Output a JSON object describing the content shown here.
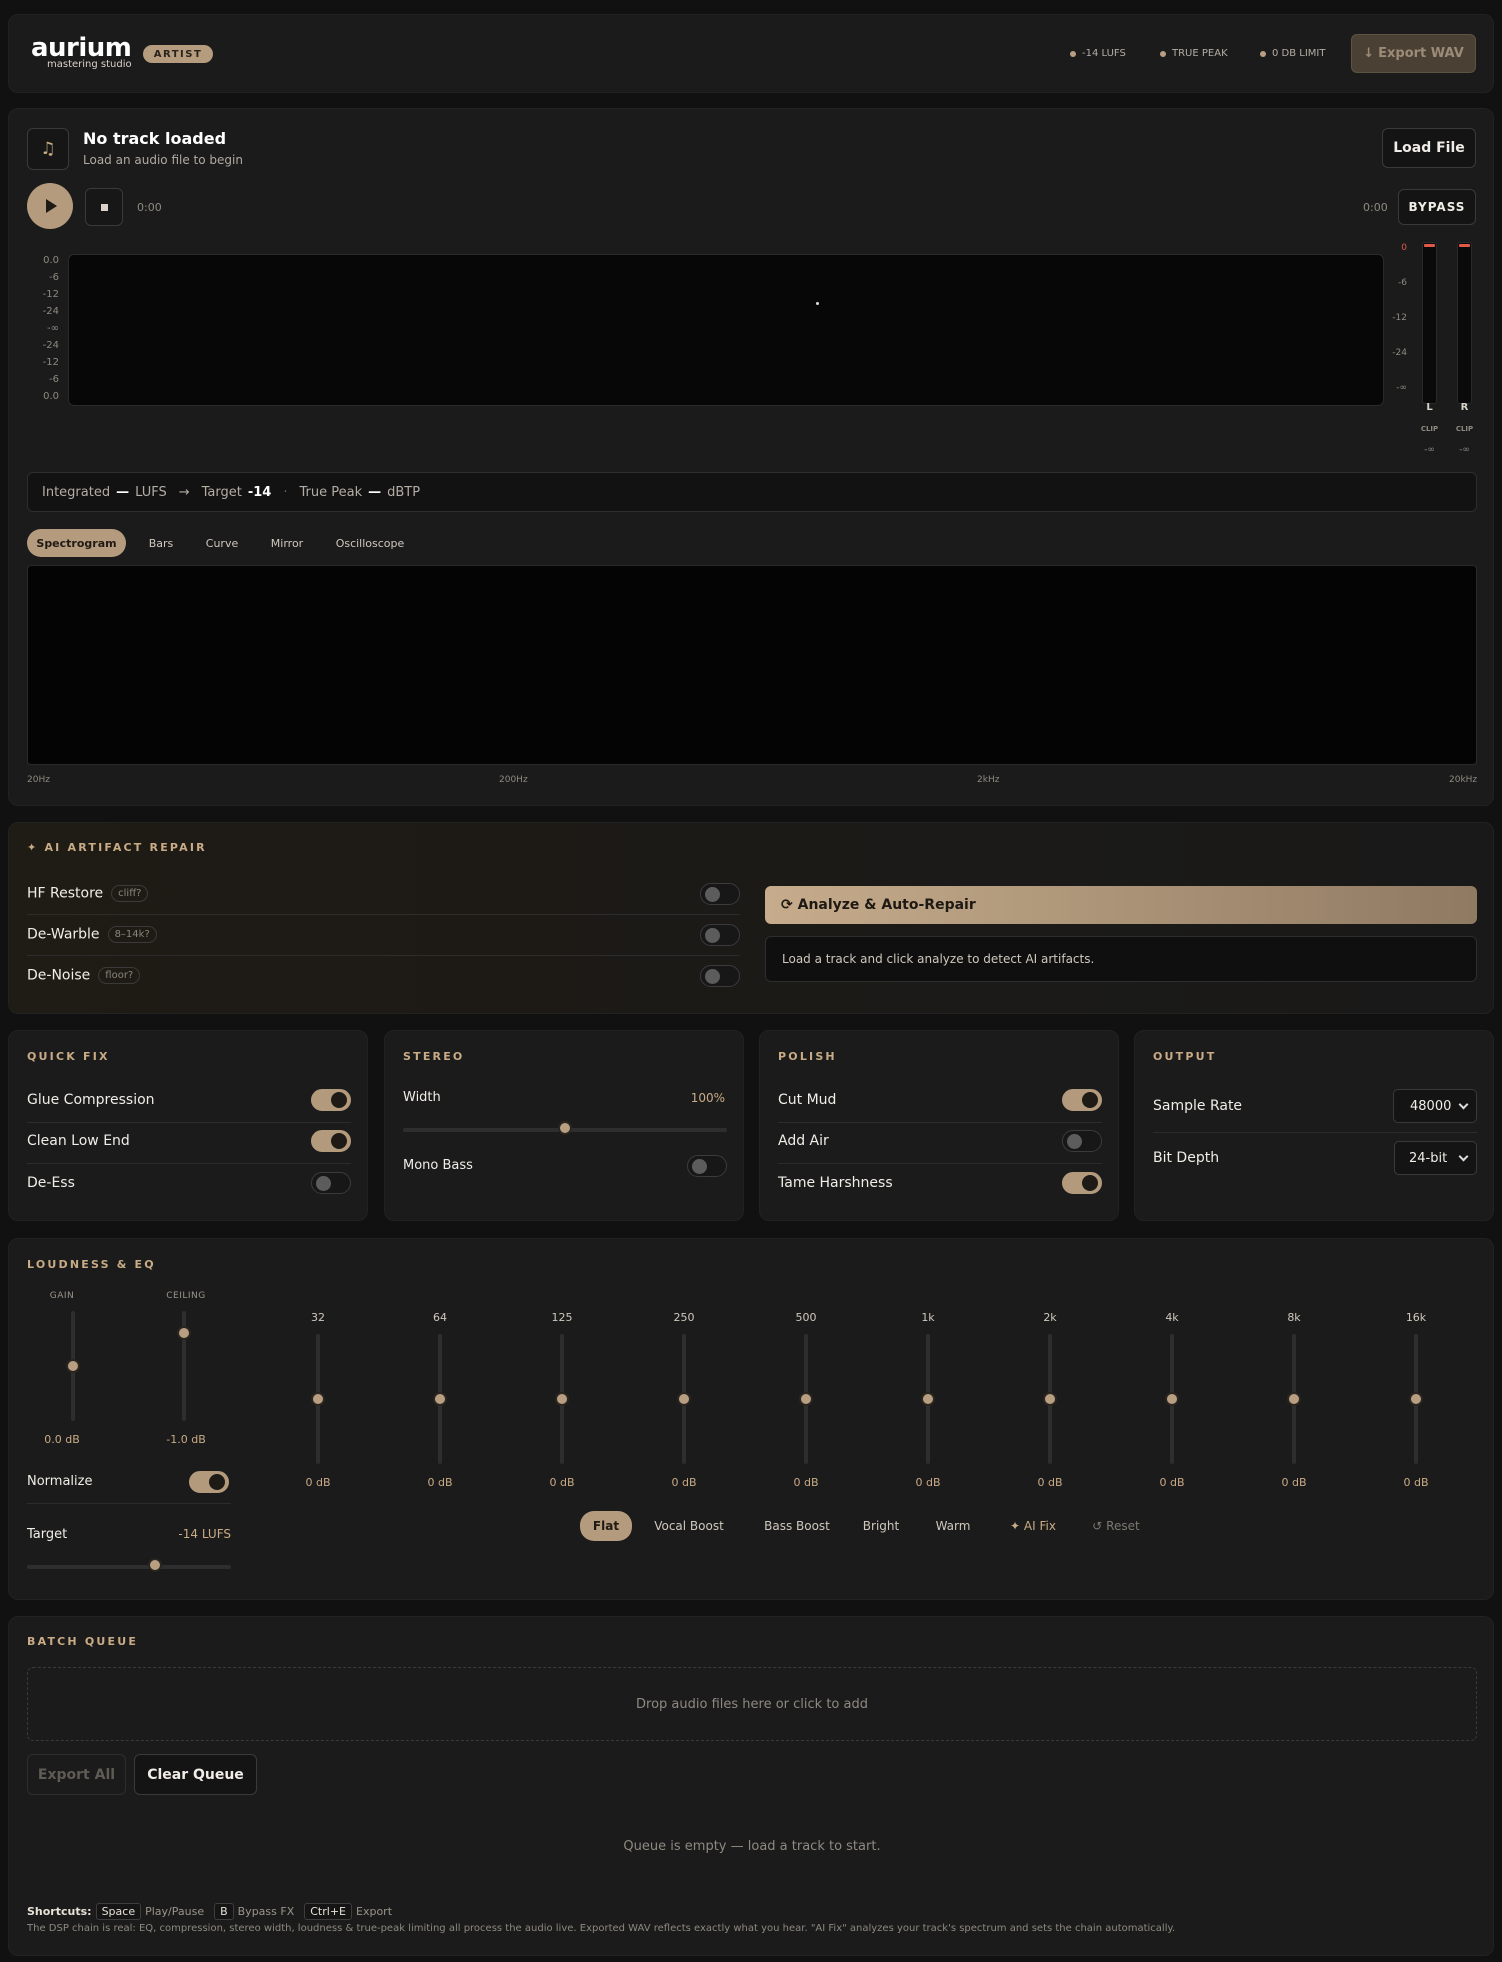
{
  "header": {
    "logo": "aurium",
    "logo_sub": "mastering studio",
    "badge": "ARTIST",
    "status": [
      "-14 LUFS",
      "TRUE PEAK",
      "0 DB LIMIT"
    ],
    "export_label": "Export WAV",
    "export_icon": "download-arrow-icon"
  },
  "track": {
    "title": "No track loaded",
    "subtitle": "Load an audio file to begin",
    "load_label": "Load File",
    "time_current": "0:00",
    "time_total": "0:00",
    "bypass_label": "BYPASS"
  },
  "waveform": {
    "ticks": [
      "0.0",
      "-6",
      "-12",
      "-24",
      "-∞",
      "-24",
      "-12",
      "-6",
      "0.0"
    ]
  },
  "meter": {
    "ticks": [
      "0",
      "-6",
      "-12",
      "-24",
      "-∞"
    ],
    "channels": [
      {
        "label": "L",
        "clip": "CLIP",
        "value": "-∞"
      },
      {
        "label": "R",
        "clip": "CLIP",
        "value": "-∞"
      }
    ]
  },
  "loudness_bar": {
    "integrated_label": "Integrated",
    "integrated_value": "—",
    "integrated_unit": "LUFS",
    "arrow": "→",
    "target_label": "Target",
    "target_value": "-14",
    "sep": "·",
    "peak_label": "True Peak",
    "peak_value": "—",
    "peak_unit": "dBTP"
  },
  "viz_tabs": [
    "Spectrogram",
    "Bars",
    "Curve",
    "Mirror",
    "Oscilloscope"
  ],
  "viz_active": "Spectrogram",
  "freq_axis": [
    "20Hz",
    "200Hz",
    "2kHz",
    "20kHz"
  ],
  "ai_repair": {
    "title": "✦ AI ARTIFACT REPAIR",
    "items": [
      {
        "label": "HF Restore",
        "tag": "cliff?",
        "on": false
      },
      {
        "label": "De-Warble",
        "tag": "8–14k?",
        "on": false
      },
      {
        "label": "De-Noise",
        "tag": "floor?",
        "on": false
      }
    ],
    "analyze_label": "⟳ Analyze & Auto-Repair",
    "message": "Load a track and click analyze to detect AI artifacts."
  },
  "quick_fix": {
    "title": "QUICK FIX",
    "items": [
      {
        "label": "Glue Compression",
        "on": true
      },
      {
        "label": "Clean Low End",
        "on": true
      },
      {
        "label": "De-Ess",
        "on": false
      }
    ]
  },
  "stereo": {
    "title": "STEREO",
    "width_label": "Width",
    "width_value": "100%",
    "width_fraction": 0.5,
    "mono_bass_label": "Mono Bass",
    "mono_bass_on": false
  },
  "polish": {
    "title": "POLISH",
    "items": [
      {
        "label": "Cut Mud",
        "on": true
      },
      {
        "label": "Add Air",
        "on": false
      },
      {
        "label": "Tame Harshness",
        "on": true
      }
    ]
  },
  "output": {
    "title": "OUTPUT",
    "sample_rate_label": "Sample Rate",
    "sample_rate_value": "48000",
    "bit_depth_label": "Bit Depth",
    "bit_depth_value": "24-bit"
  },
  "loudness_eq": {
    "title": "LOUDNESS & EQ",
    "gain_label": "GAIN",
    "gain_value": "0.0 dB",
    "gain_fraction": 0.5,
    "ceiling_label": "CEILING",
    "ceiling_value": "-1.0 dB",
    "ceiling_fraction": 0.8,
    "normalize_label": "Normalize",
    "normalize_on": true,
    "target_label": "Target",
    "target_value": "-14 LUFS",
    "target_fraction": 0.63,
    "bands": [
      {
        "freq": "32",
        "value": "0 dB"
      },
      {
        "freq": "64",
        "value": "0 dB"
      },
      {
        "freq": "125",
        "value": "0 dB"
      },
      {
        "freq": "250",
        "value": "0 dB"
      },
      {
        "freq": "500",
        "value": "0 dB"
      },
      {
        "freq": "1k",
        "value": "0 dB"
      },
      {
        "freq": "2k",
        "value": "0 dB"
      },
      {
        "freq": "4k",
        "value": "0 dB"
      },
      {
        "freq": "8k",
        "value": "0 dB"
      },
      {
        "freq": "16k",
        "value": "0 dB"
      }
    ],
    "presets": [
      "Flat",
      "Vocal Boost",
      "Bass Boost",
      "Bright",
      "Warm",
      "✦ AI Fix",
      "↺ Reset"
    ],
    "preset_active": "Flat"
  },
  "batch": {
    "title": "BATCH QUEUE",
    "drop_text": "Drop audio files here or click to add",
    "export_all_label": "Export All",
    "clear_label": "Clear Queue",
    "empty_text": "Queue is empty — load a track to start."
  },
  "footer": {
    "shortcuts_label": "Shortcuts:",
    "shortcuts": [
      {
        "key": "Space",
        "action": "Play/Pause"
      },
      {
        "key": "B",
        "action": "Bypass FX"
      },
      {
        "key": "Ctrl+E",
        "action": "Export"
      }
    ],
    "note": "The DSP chain is real: EQ, compression, stereo width, loudness & true-peak limiting all process the audio live. Exported WAV reflects exactly what you hear. \"AI Fix\" analyzes your track's spectrum and sets the chain automatically."
  },
  "colors": {
    "accent": "#c9ab86",
    "background": "#111111",
    "panel": "#1b1b1b",
    "clip_red": "#e05a4a"
  }
}
